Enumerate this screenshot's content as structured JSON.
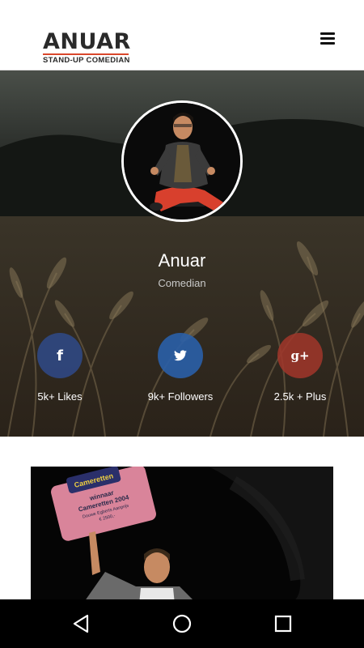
{
  "header": {
    "logo_title": "ANUAR",
    "logo_subtitle": "STAND-UP COMEDIAN",
    "menu_icon": "hamburger-menu-icon"
  },
  "profile": {
    "name": "Anuar",
    "role": "Comedian"
  },
  "social": [
    {
      "icon": "facebook-icon",
      "glyph": "f",
      "count": "5k+ Likes",
      "color": "#2f4a8a"
    },
    {
      "icon": "twitter-icon",
      "glyph": "t",
      "count": "9k+ Followers",
      "color": "#2a5fa8"
    },
    {
      "icon": "google-plus-icon",
      "glyph": "g+",
      "count": "2.5k + Plus",
      "color": "#a1362a"
    }
  ],
  "photo": {
    "sign_lines": [
      "Cameretten",
      "winnaar",
      "Cameretten 2004",
      "Douwe Egberts Aanprijs",
      "€ 2500,-"
    ]
  },
  "system_nav": {
    "back_icon": "back-triangle-icon",
    "home_icon": "home-circle-icon",
    "recents_icon": "recents-square-icon"
  },
  "colors": {
    "accent": "#d9472b",
    "facebook": "#2f4a8a",
    "twitter": "#2a5fa8",
    "google_plus": "#a1362a"
  }
}
